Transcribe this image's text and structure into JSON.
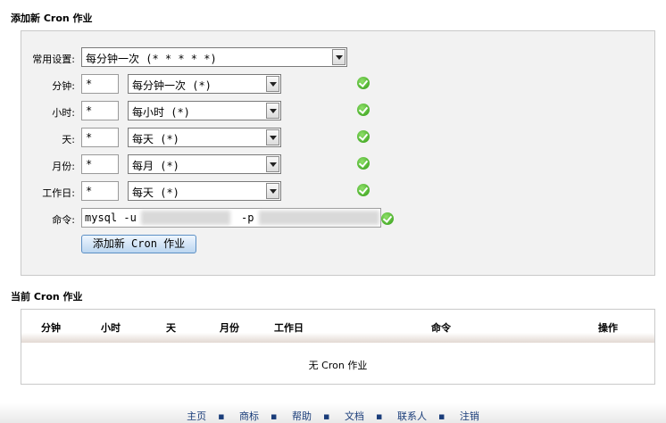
{
  "add_section": {
    "title": "添加新 Cron 作业"
  },
  "form": {
    "common_label": "常用设置:",
    "common_value": "每分钟一次 (* * * * *)",
    "rows": [
      {
        "label": "分钟:",
        "input": "*",
        "select": "每分钟一次 (*)"
      },
      {
        "label": "小时:",
        "input": "*",
        "select": "每小时 (*)"
      },
      {
        "label": "天:",
        "input": "*",
        "select": "每天 (*)"
      },
      {
        "label": "月份:",
        "input": "*",
        "select": "每月 (*)"
      },
      {
        "label": "工作日:",
        "input": "*",
        "select": "每天 (*)"
      }
    ],
    "command_label": "命令:",
    "command_value_start": "mysql -u",
    "command_value_mid": "-p",
    "submit_label": "添加新 Cron 作业"
  },
  "current_section": {
    "title": "当前 Cron 作业",
    "columns": [
      "分钟",
      "小时",
      "天",
      "月份",
      "工作日",
      "命令",
      "操作"
    ],
    "empty_text": "无 Cron 作业"
  },
  "footer": {
    "links": [
      "主页",
      "商标",
      "帮助",
      "文档",
      "联系人",
      "注销"
    ]
  },
  "colors": {
    "ok": "#2f9a12",
    "link": "#1a3d7a",
    "button": "#bcd6f0"
  },
  "icons": {
    "valid": "check-circle-icon"
  }
}
